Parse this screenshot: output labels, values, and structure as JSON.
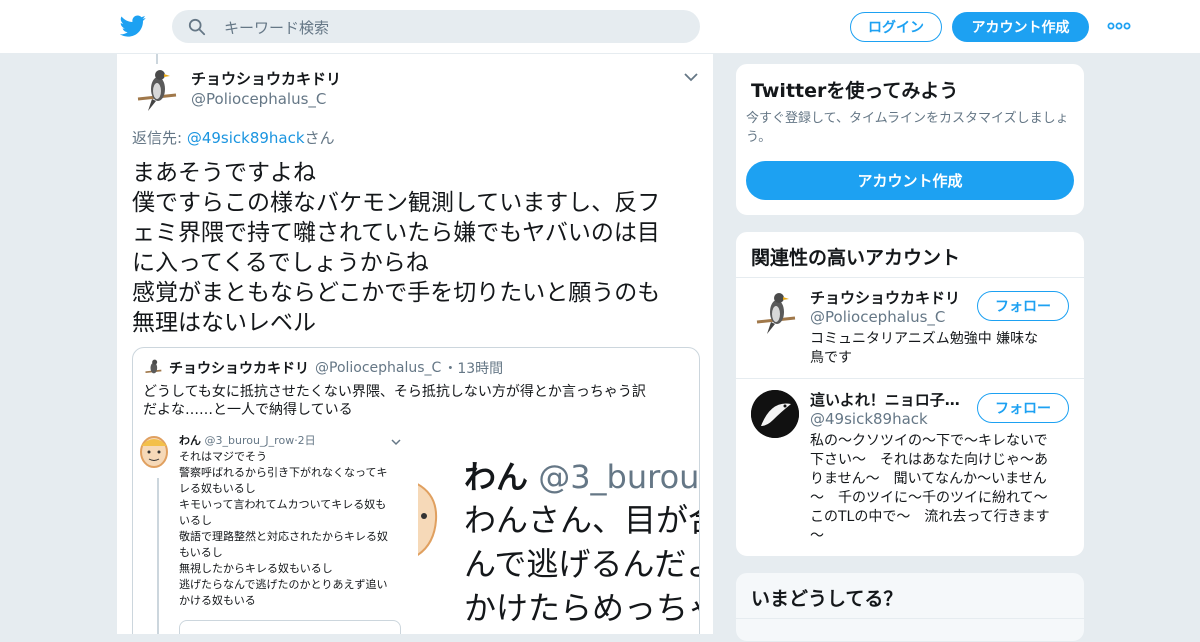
{
  "header": {
    "search_placeholder": "キーワード検索",
    "login_label": "ログイン",
    "signup_label": "アカウント作成"
  },
  "tweet": {
    "author_name": "チョウショウカキドリ",
    "author_handle": "@Poliocephalus_C",
    "reply_prefix": "返信先: ",
    "reply_handle": "@49sick89hack",
    "reply_suffix": "さん",
    "text_lines": [
      "まあそうですよね",
      "僕ですらこの様なバケモン観測していますし、反フ",
      "ェミ界隈で持て囃されていたら嫌でもヤバいのは目",
      "に入ってくるでしょうからね",
      "感覚がまともならどこかで手を切りたいと願うのも",
      "無理はないレベル"
    ],
    "quote": {
      "author_name": "チョウショウカキドリ",
      "author_handle": "@Poliocephalus_C",
      "sep": "・",
      "time": "13時間",
      "text_line1": "どうしても女に抵抗させたくない界隈、そら抵抗しない方が得とか言っちゃう訳",
      "text_line2": "だよな……と一人で納得している",
      "image_left": {
        "name": "わん",
        "handle": "@3_burou_J_row",
        "time": "·2日",
        "lines": [
          "それはマジでそう",
          "警察呼ばれるから引き下がれなくなってキ",
          "レる奴もいるし",
          "キモいって言われてムカついてキレる奴も",
          "いるし",
          "敬語で理路整然と対応されたからキレる奴",
          "もいるし",
          "無視したからキレる奴もいるし",
          "逃げたらなんで逃げたのかとりあえず追い",
          "かける奴もいる"
        ]
      },
      "image_right": {
        "name": "わん",
        "handle": "@3_burou_",
        "lines": [
          "わんさん、目が合",
          "んで逃げるんだよ",
          "かけたらめっちゃ"
        ]
      }
    }
  },
  "sidebar": {
    "try_title": "Twitterを使ってみよう",
    "try_desc_line1": "今すぐ登録して、タイムラインをカスタマイズしましょ",
    "try_desc_line2": "う。",
    "try_button": "アカウント作成",
    "related_title": "関連性の高いアカウント",
    "accounts": [
      {
        "name": "チョウショウカキドリ",
        "handle": "@Poliocephalus_C",
        "follow": "フォロー",
        "bio_lines": [
          "コミュニタリアニズム勉強中 嫌味な",
          "鳥です"
        ]
      },
      {
        "name": "這いよれ！ニョロ子…",
        "handle": "@49sick89hack",
        "follow": "フォロー",
        "bio_lines": [
          "私の～クソツイの～下で～キレないで",
          "下さい～　それはあなた向けじゃ～あ",
          "りません～　聞いてなんか～いません",
          "～　千のツイに～千のツイに紛れて～",
          "このTLの中で～　流れ去って行きます",
          "～"
        ]
      }
    ],
    "now_title": "いまどうしてる？"
  },
  "colors": {
    "accent": "#1da1f2",
    "link": "#1b95e0",
    "muted": "#657786",
    "background": "#e6ecf0"
  }
}
